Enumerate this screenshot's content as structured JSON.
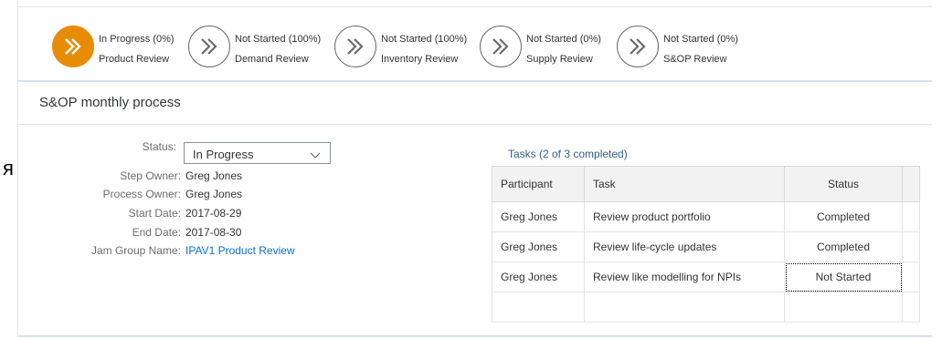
{
  "stray_char": "я",
  "steps": [
    {
      "status": "In Progress (0%)",
      "name": "Product Review",
      "active": true
    },
    {
      "status": "Not Started (100%)",
      "name": "Demand Review",
      "active": false
    },
    {
      "status": "Not Started (100%)",
      "name": "Inventory Review",
      "active": false
    },
    {
      "status": "Not Started (0%)",
      "name": "Supply Review",
      "active": false
    },
    {
      "status": "Not Started (0%)",
      "name": "S&OP Review",
      "active": false
    }
  ],
  "section": {
    "title": "S&OP monthly process"
  },
  "form": {
    "status_label": "Status:",
    "status_value": "In Progress",
    "step_owner_label": "Step Owner:",
    "step_owner_value": "Greg Jones",
    "process_owner_label": "Process Owner:",
    "process_owner_value": "Greg Jones",
    "start_date_label": "Start Date:",
    "start_date_value": "2017-08-29",
    "end_date_label": "End Date:",
    "end_date_value": "2017-08-30",
    "jam_group_label": "Jam Group Name:",
    "jam_group_value": "IPAV1 Product Review"
  },
  "tasks": {
    "title": "Tasks (2 of 3 completed)",
    "columns": {
      "participant": "Participant",
      "task": "Task",
      "status": "Status"
    },
    "rows": [
      {
        "participant": "Greg Jones",
        "task": "Review product portfolio",
        "status": "Completed"
      },
      {
        "participant": "Greg Jones",
        "task": "Review life-cycle updates",
        "status": "Completed"
      },
      {
        "participant": "Greg Jones",
        "task": "Review like modelling for NPIs",
        "status": "Not Started"
      }
    ]
  },
  "colors": {
    "accent": "#e78c07",
    "link": "#0a6ed1",
    "completed": "#2b7d2b"
  },
  "icons": {
    "step": "fast-forward-icon",
    "dropdown": "chevron-down-icon"
  }
}
